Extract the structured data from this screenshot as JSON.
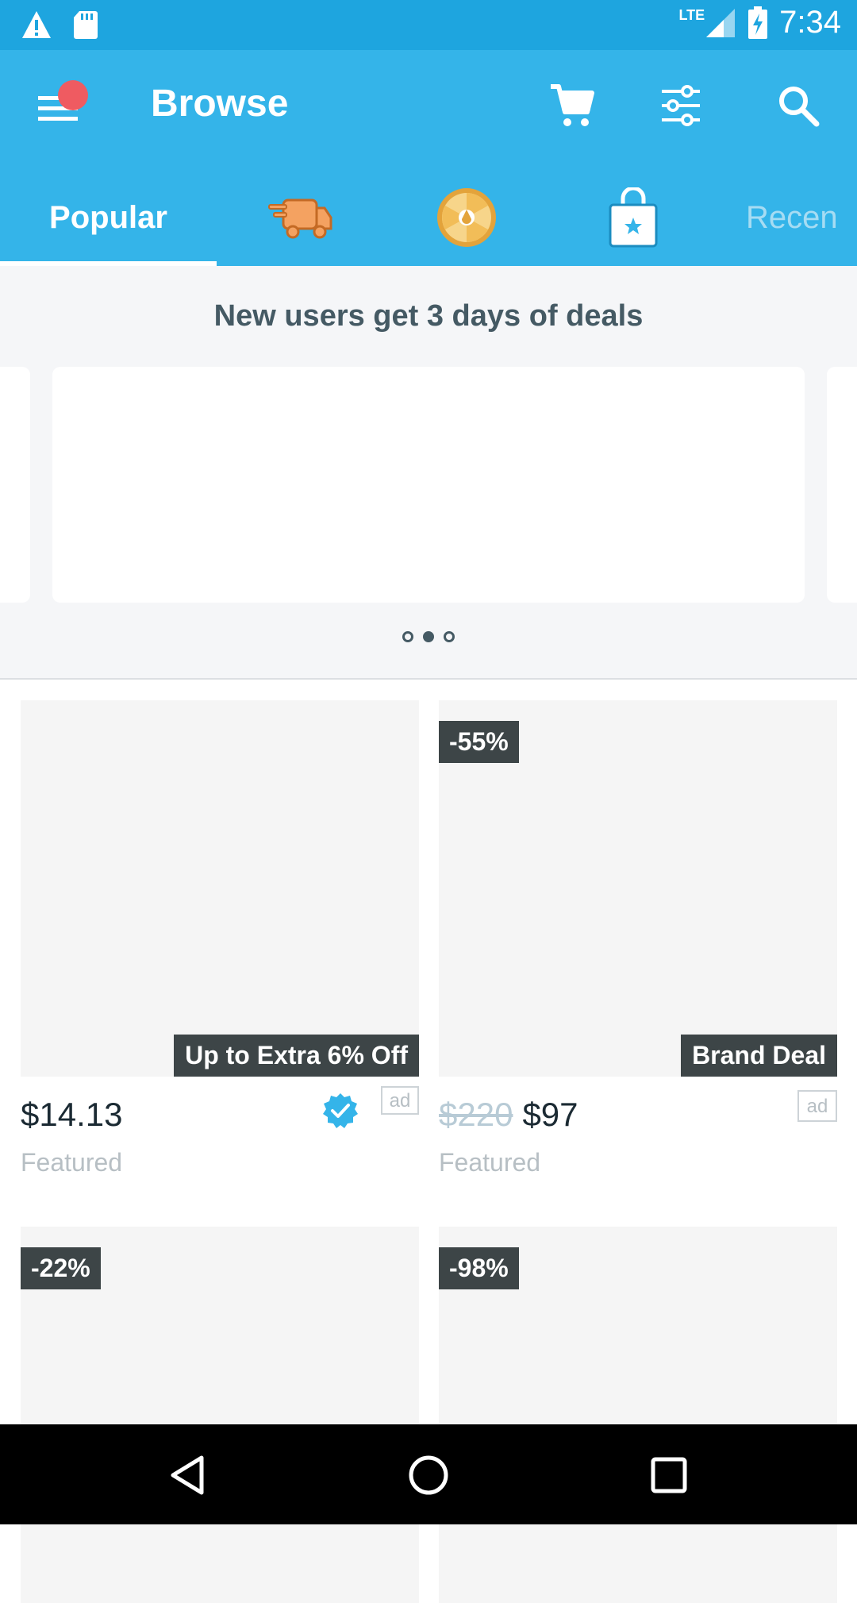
{
  "status_bar": {
    "time": "7:34",
    "network": "LTE"
  },
  "app_bar": {
    "title": "Browse"
  },
  "tabs": [
    {
      "label": "Popular",
      "icon": ""
    },
    {
      "label": "",
      "icon": "delivery-truck-icon"
    },
    {
      "label": "",
      "icon": "wheel-icon"
    },
    {
      "label": "",
      "icon": "shopping-bag-star-icon"
    },
    {
      "label": "Recen",
      "icon": ""
    }
  ],
  "banner": {
    "text": "New users get 3 days of deals",
    "carousel_pages": 3,
    "active_page": 2
  },
  "products": [
    {
      "discount": "",
      "deal_label": "Up to Extra 6% Off",
      "old_price": "",
      "price": "$14.13",
      "tag": "Featured",
      "ad": "ad",
      "verified": true
    },
    {
      "discount": "-55%",
      "deal_label": "Brand Deal",
      "old_price": "$220",
      "price": "$97",
      "tag": "Featured",
      "ad": "ad",
      "verified": false
    },
    {
      "discount": "-22%",
      "deal_label": "",
      "old_price": "",
      "price": "",
      "tag": "",
      "ad": "",
      "verified": false
    },
    {
      "discount": "-98%",
      "deal_label": "",
      "old_price": "",
      "price": "",
      "tag": "",
      "ad": "",
      "verified": false
    }
  ],
  "colors": {
    "primary": "#34b4e9",
    "status_bar": "#1ea5df",
    "badge": "#3d4547",
    "notification": "#ef5b61"
  }
}
